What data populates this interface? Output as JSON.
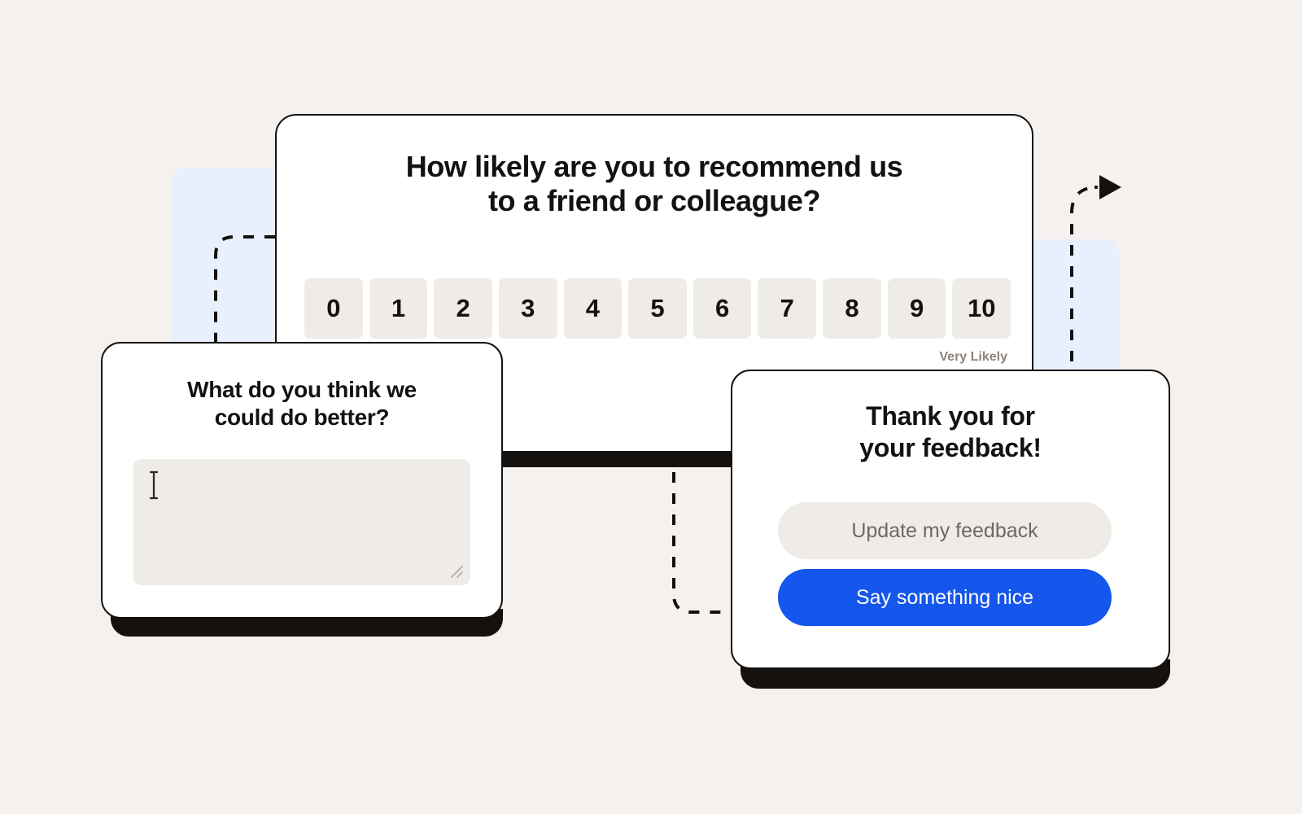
{
  "theme": {
    "background": "#f5f1ee",
    "accent_blue": "#1556ec",
    "panel_blue": "#e8f0fd",
    "field_gray": "#efebe7",
    "ink": "#14110f",
    "muted_text": "#8b847e"
  },
  "nps_card": {
    "title_line1": "How likely are you to recommend us",
    "title_line2": "to a friend or colleague?",
    "scale_options": [
      "0",
      "1",
      "2",
      "3",
      "4",
      "5",
      "6",
      "7",
      "8",
      "9",
      "10"
    ],
    "legend_right": "Very Likely"
  },
  "feedback_card": {
    "title_line1": "What do you think we",
    "title_line2": "could do better?",
    "textarea_value": "",
    "textarea_placeholder": "",
    "cursor_icon": "text-caret-icon",
    "resize_icon": "resize-grip-icon"
  },
  "thanks_card": {
    "title_line1": "Thank you for",
    "title_line2": "your feedback!",
    "secondary_button": "Update my feedback",
    "primary_button": "Say something nice"
  },
  "decorations": {
    "arrow_icon": "arrow-head-icon",
    "connector_left": "dashed-connector-left",
    "connector_right": "dashed-connector-right",
    "connector_bottom": "dashed-connector-bottom"
  }
}
